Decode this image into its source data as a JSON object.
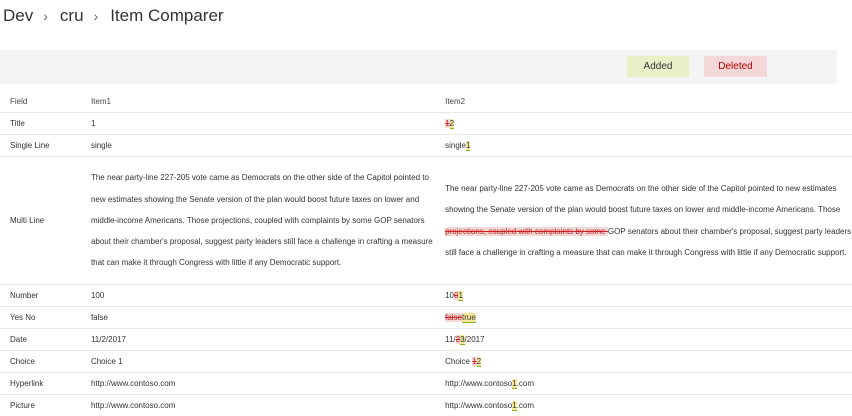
{
  "breadcrumb": {
    "items": [
      "Dev",
      "cru",
      "Item Comparer"
    ],
    "separator": "›"
  },
  "legend": {
    "added_label": "Added",
    "deleted_label": "Deleted",
    "added_color": "#e8f0c8",
    "deleted_color": "#f4d7d7"
  },
  "table": {
    "headers": {
      "field": "Field",
      "item1": "Item1",
      "item2": "Item2"
    },
    "rows": [
      {
        "field": "Title",
        "item1": "1",
        "item2": [
          {
            "t": "del",
            "v": "1"
          },
          {
            "t": "ins",
            "v": "2"
          }
        ]
      },
      {
        "field": "Single Line",
        "item1": "single",
        "item2": [
          {
            "t": "eq",
            "v": "single"
          },
          {
            "t": "ins",
            "v": "1"
          }
        ]
      },
      {
        "field": "Multi Line",
        "item1": "The near party-line 227-205 vote came as Democrats on the other side of the Capitol pointed to new estimates showing the Senate version of the plan would boost future taxes on lower and middle-income Americans. Those projections, coupled with complaints by some GOP senators about their chamber's proposal, suggest party leaders still face a challenge in crafting a measure that can make it through Congress with little if any Democratic support.",
        "item2": [
          {
            "t": "eq",
            "v": "The near party-line 227-205 vote came as Democrats on the other side of the Capitol pointed to new estimates showing the Senate version of the plan would boost future taxes on lower and middle-income Americans. Those "
          },
          {
            "t": "del",
            "v": "projections, coupled with complaints by some "
          },
          {
            "t": "eq",
            "v": "GOP senators about their chamber's proposal, suggest party leaders still face a challenge in crafting a measure that can make it through Congress with little if any Democratic support."
          }
        ]
      },
      {
        "field": "Number",
        "item1": "100",
        "item2": [
          {
            "t": "eq",
            "v": "10"
          },
          {
            "t": "del",
            "v": "0"
          },
          {
            "t": "ins",
            "v": "1"
          }
        ]
      },
      {
        "field": "Yes No",
        "item1": "false",
        "item2": [
          {
            "t": "del",
            "v": "false"
          },
          {
            "t": "ins",
            "v": "true"
          }
        ]
      },
      {
        "field": "Date",
        "item1": "11/2/2017",
        "item2": [
          {
            "t": "eq",
            "v": "11/"
          },
          {
            "t": "del",
            "v": "2"
          },
          {
            "t": "ins",
            "v": "3"
          },
          {
            "t": "eq",
            "v": "/2017"
          }
        ]
      },
      {
        "field": "Choice",
        "item1": "Choice 1",
        "item2": [
          {
            "t": "eq",
            "v": "Choice "
          },
          {
            "t": "del",
            "v": "1"
          },
          {
            "t": "ins",
            "v": "2"
          }
        ]
      },
      {
        "field": "Hyperlink",
        "item1": "http://www.contoso.com",
        "item2": [
          {
            "t": "eq",
            "v": "http://www.contoso"
          },
          {
            "t": "ins",
            "v": "1"
          },
          {
            "t": "eq",
            "v": ".com"
          }
        ]
      },
      {
        "field": "Picture",
        "item1": "http://www.contoso.com",
        "item2": [
          {
            "t": "eq",
            "v": "http://www.contoso"
          },
          {
            "t": "ins",
            "v": "1"
          },
          {
            "t": "eq",
            "v": ".com"
          }
        ]
      }
    ]
  }
}
